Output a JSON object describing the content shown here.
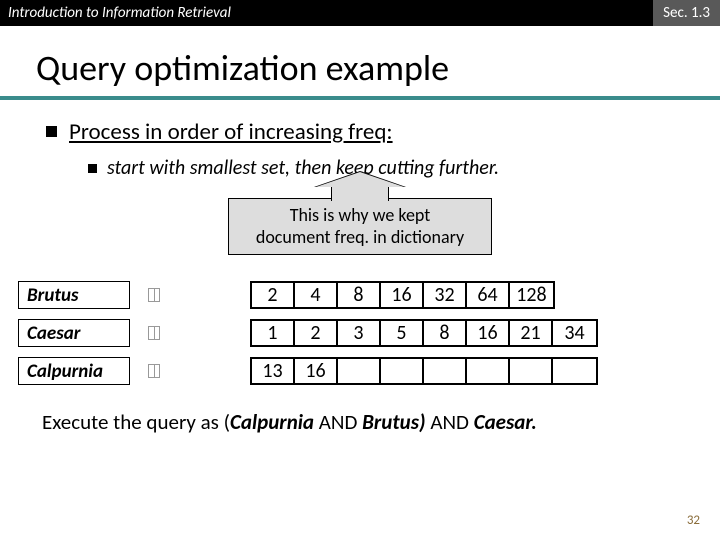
{
  "header": {
    "left": "Introduction to Information Retrieval",
    "right": "Sec. 1.3"
  },
  "title": "Query optimization example",
  "bullets": {
    "l1": "Process in order of increasing freq:",
    "l2": "start with smallest set, then keep cutting further."
  },
  "callout": {
    "line1": "This is why we kept",
    "line2": "document freq. in dictionary"
  },
  "terms": {
    "brutus": {
      "name": "Brutus",
      "list": [
        "2",
        "4",
        "8",
        "16",
        "32",
        "64",
        "128"
      ]
    },
    "caesar": {
      "name": "Caesar",
      "list": [
        "1",
        "2",
        "3",
        "5",
        "8",
        "16",
        "21",
        "34"
      ]
    },
    "calpurnia": {
      "name": "Calpurnia",
      "list": [
        "13",
        "16",
        "",
        "",
        "",
        "",
        "",
        ""
      ]
    }
  },
  "footer": {
    "pre": "Execute the query as (",
    "a": "Calpurnia ",
    "and1": "AND ",
    "b": "Brutus) ",
    "and2": "AND ",
    "c": "Caesar.",
    "rm": ""
  },
  "pagenum": "32"
}
